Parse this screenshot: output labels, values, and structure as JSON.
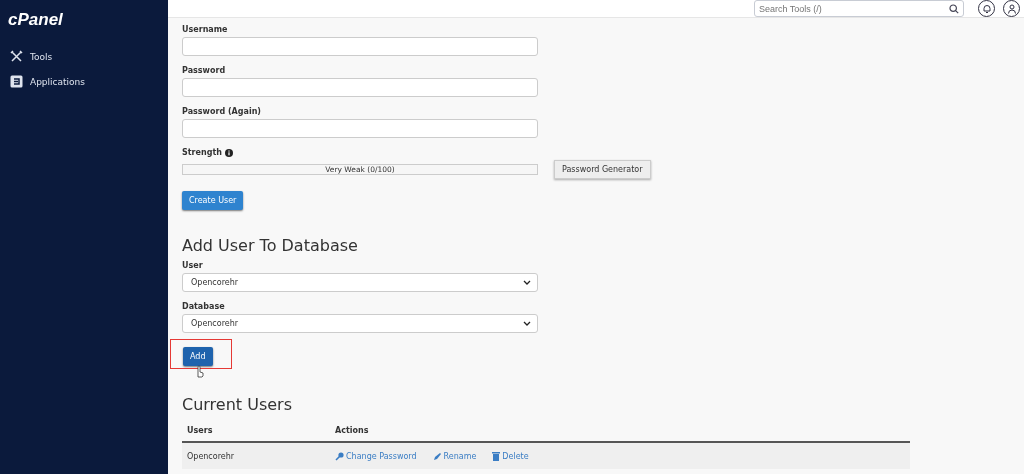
{
  "sidebar": {
    "logo": "cPanel",
    "items": [
      {
        "label": "Tools",
        "kind": "tools"
      },
      {
        "label": "Applications",
        "kind": "apps"
      }
    ]
  },
  "topbar": {
    "search": {
      "placeholder": "Search Tools (/)"
    }
  },
  "create_user": {
    "fields": [
      {
        "label": "Username"
      },
      {
        "label": "Password"
      },
      {
        "label": "Password (Again)"
      }
    ],
    "strength": {
      "label": "Strength",
      "level": 0,
      "reading": "Very Weak (0/100)"
    },
    "generator_button": "Password Generator",
    "submit_button": "Create User"
  },
  "add_user": {
    "title": "Add User To Database",
    "selects": [
      {
        "label": "User",
        "value": "Opencorehr"
      },
      {
        "label": "Database",
        "value": "Opencorehr"
      }
    ],
    "button": "Add",
    "highlighted": true
  },
  "current_users": {
    "title": "Current Users",
    "columns": [
      "Users",
      "Actions"
    ],
    "rows": [
      {
        "user": "Opencorehr",
        "actions": [
          {
            "label": "Change Password",
            "kind": "key"
          },
          {
            "label": "Rename",
            "kind": "pencil"
          },
          {
            "label": "Delete",
            "kind": "trash"
          }
        ]
      }
    ]
  }
}
